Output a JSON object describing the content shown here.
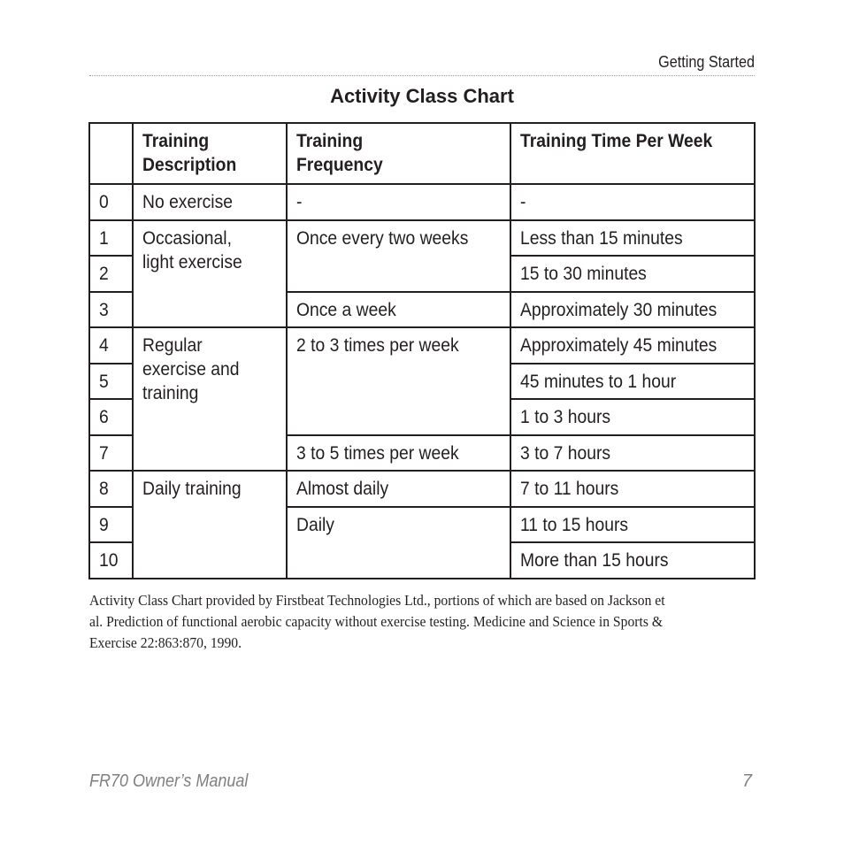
{
  "page": {
    "section": "Getting Started",
    "title": "Activity Class Chart",
    "footer_manual": "FR70 Owner’s Manual",
    "page_number": "7"
  },
  "table": {
    "headers": [
      "",
      "Training Description",
      "Training Frequency",
      "Training Time Per Week"
    ],
    "header_lines": {
      "description": "Training\nDescription",
      "frequency": "Training\nFrequency",
      "time": "Training Time Per Week"
    },
    "rows": [
      {
        "class": "0",
        "time": "-"
      },
      {
        "class": "1",
        "time": "Less than 15 minutes"
      },
      {
        "class": "2",
        "time": "15 to 30 minutes"
      },
      {
        "class": "3",
        "time": "Approximately 30 minutes"
      },
      {
        "class": "4",
        "time": "Approximately 45 minutes"
      },
      {
        "class": "5",
        "time": "45 minutes to 1 hour"
      },
      {
        "class": "6",
        "time": "1 to 3 hours"
      },
      {
        "class": "7",
        "time": "3 to 7 hours"
      },
      {
        "class": "8",
        "time": "7 to 11 hours"
      },
      {
        "class": "9",
        "time": "11 to 15 hours"
      },
      {
        "class": "10",
        "time": "More than 15 hours"
      }
    ],
    "descriptions": [
      {
        "text": "No exercise",
        "rows": "0"
      },
      {
        "text": "Occasional,\nlight exercise",
        "rows": "1-3"
      },
      {
        "text": "Regular\nexercise and\ntraining",
        "rows": "4-7"
      },
      {
        "text": "Daily training",
        "rows": "8-10"
      }
    ],
    "frequencies": [
      {
        "text": "-",
        "rows": "0"
      },
      {
        "text": "Once every two weeks",
        "rows": "1-2"
      },
      {
        "text": "Once a week",
        "rows": "3"
      },
      {
        "text": "2 to 3 times per week",
        "rows": "4-6"
      },
      {
        "text": "3 to 5 times per week",
        "rows": "7"
      },
      {
        "text": "Almost daily",
        "rows": "8"
      },
      {
        "text": "Daily",
        "rows": "9-10"
      }
    ]
  },
  "footnote": "Activity Class Chart provided by Firstbeat Technologies Ltd., portions of which are based on Jackson et\nal. Prediction of functional aerobic capacity without exercise testing. Medicine and Science in Sports &\nExercise 22:863:870, 1990."
}
